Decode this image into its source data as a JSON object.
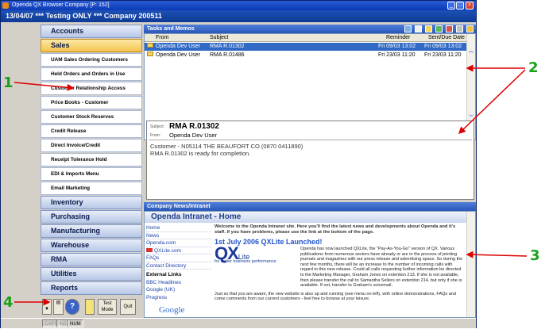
{
  "window": {
    "title": "Openda QX Browser    Company [P: 152]",
    "header": "13/04/07 *** Testing ONLY ***   Company  200511"
  },
  "nav": {
    "main_top": [
      {
        "label": "Accounts",
        "active": false
      },
      {
        "label": "Sales",
        "active": true
      }
    ],
    "sub_items": [
      "UAM Sales Ordering Customers",
      "Held Orders and Orders in Use",
      "Customer Relationship Access",
      "Price Books - Customer",
      "Customer Stock Reserves",
      "Credit Release",
      "Direct Invoice/Credit",
      "Receipt Tolerance Hold",
      "EDI & Imports Menu",
      "Email Marketing"
    ],
    "main_bottom": [
      "Inventory",
      "Purchasing",
      "Manufacturing",
      "Warehouse",
      "RMA",
      "Utilities",
      "Reports"
    ],
    "bottom_buttons": {
      "test_mode": "Test Mode",
      "quit": "Quit",
      "help_icon": "?"
    }
  },
  "tasks": {
    "header": "Tasks and Memos",
    "columns": {
      "from": "From",
      "subject": "Subject",
      "reminder": "Reminder",
      "sent": "Sent/Due Date"
    },
    "rows": [
      {
        "from": "Openda Dev User",
        "subject": "RMA R.01302",
        "reminder": "Fri 09/03 13:02",
        "sent": "Fri 09/03 13:02",
        "selected": true
      },
      {
        "from": "Openda Dev User",
        "subject": "RMA R.01486",
        "reminder": "Fri 23/03 11:20",
        "sent": "Fri 23/03 11:20",
        "selected": false
      }
    ]
  },
  "preview": {
    "subject_label": "Subject:",
    "subject": "RMA R.01302",
    "from_label": "From:",
    "from": "Openda Dev User",
    "body_line1": "Customer - N05114 THE BEAUFORT CO (0870 0411890)",
    "body_line2": "RMA R.01302 is ready for completion."
  },
  "news": {
    "header": "Company News/Intranet",
    "title": "Openda Intranet - Home",
    "nav_links": [
      "Home",
      "News",
      "Openda.com",
      "QXLite.com",
      "FAQs",
      "Contact Directory"
    ],
    "external_heading": "External Links",
    "external_links": [
      "BBC Headlines",
      "Google (UK)",
      "Progress"
    ],
    "google": "Google",
    "intro": "Welcome to the Openda Intranet site. Here you'll find the latest news and developments about Openda and it's staff. If you have problems, please use the link at the bottom of the page.",
    "headline": "1st July 2006 QXLite Launched!",
    "logo_big": "QX",
    "logo_small": "Lite",
    "tagline": "for better business performance",
    "para1": "Openda has now launched QXLite, the \"Pay-As-You-Go\" version of QX. Various publications from numerous sectors have already or are in the process of printing journals and magazines with our press release and advertising space. So during the next few months, there will be an increase to the number of incoming calls with regard to this new release. Could all calls requesting further information be directed to the Marketing Manager, Graham Jones on extention 213. If she is not available, then please transfer the call to Samantha Sellers on extention 214, but only if she is available. If not, transfer to Graham's voicemail.",
    "para2": "Just so that you are aware, the new website is also up and running (see menu on left), with online demonstrations, FAQs and come comments from our current customers - feel free to browse at your leisure."
  },
  "statusbar": [
    "CAPS",
    "INS",
    "NUM"
  ],
  "callouts": {
    "c1": "1",
    "c2": "2",
    "c3": "3",
    "c4": "4"
  },
  "colors": {
    "callout": "#1aa01a",
    "header": "#0e3a94",
    "selected_row": "#316ac5"
  }
}
